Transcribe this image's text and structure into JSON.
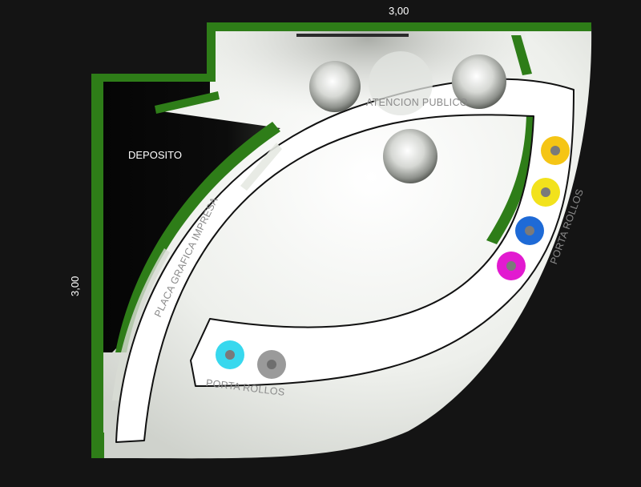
{
  "dimensions": {
    "top": "3,00",
    "left": "3,00"
  },
  "labels": {
    "deposito": "DEPOSITO",
    "atencion_publico": "ATENCION PUBLICO",
    "placa_grafica": "PLACA GRAFICA IMPRESA",
    "porta_rollos_bottom": "PORTA ROLLOS",
    "porta_rollos_right": "PORTA ROLLOS"
  },
  "colors": {
    "background": "#141414",
    "floor": "#f4f5f2",
    "wall_green": "#2e7d18",
    "outline": "#111111"
  },
  "rolls": [
    {
      "name": "cyan",
      "color": "#38d8ee"
    },
    {
      "name": "gray",
      "color": "#9a9a9a"
    },
    {
      "name": "magenta",
      "color": "#e21ad0"
    },
    {
      "name": "blue",
      "color": "#1e6ad6"
    },
    {
      "name": "yellow",
      "color": "#f2e21c"
    },
    {
      "name": "yellow-orange",
      "color": "#f5c515"
    }
  ],
  "stools": [
    {
      "name": "stool-1"
    },
    {
      "name": "stool-2"
    },
    {
      "name": "stool-3"
    },
    {
      "name": "stool-4"
    }
  ]
}
